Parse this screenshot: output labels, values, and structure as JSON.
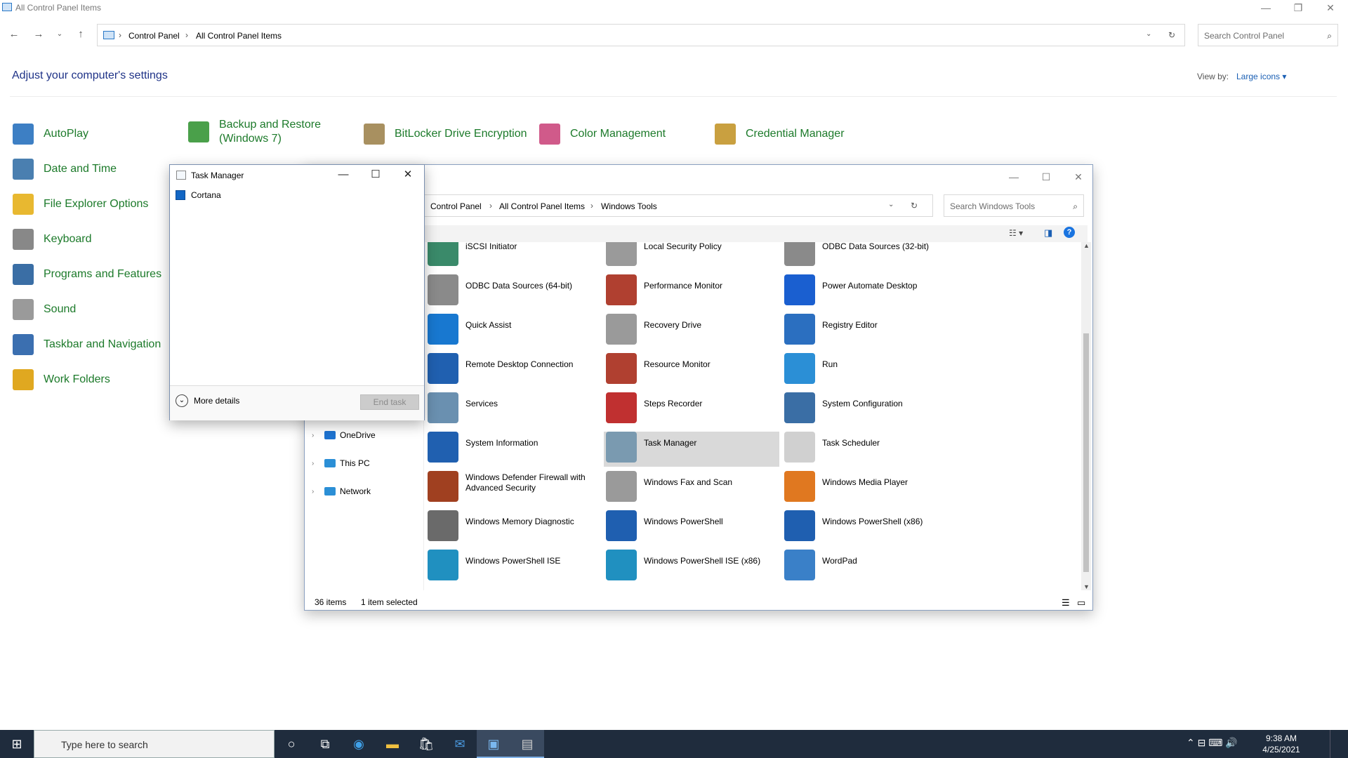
{
  "control_panel": {
    "title": "All Control Panel Items",
    "breadcrumb": [
      "Control Panel",
      "All Control Panel Items"
    ],
    "search_placeholder": "Search Control Panel",
    "heading": "Adjust your computer's settings",
    "view_by_label": "View by:",
    "view_by_value": "Large icons ▾",
    "items": [
      {
        "label": "AutoPlay",
        "icon": "autoplay-icon",
        "color": "#3d7fc4"
      },
      {
        "label": "Backup and Restore\n(Windows 7)",
        "icon": "backup-restore-icon",
        "color": "#4aa04a"
      },
      {
        "label": "BitLocker Drive Encryption",
        "icon": "bitlocker-icon",
        "color": "#a89060"
      },
      {
        "label": "Color Management",
        "icon": "color-management-icon",
        "color": "#d05a8a"
      },
      {
        "label": "Credential Manager",
        "icon": "credential-manager-icon",
        "color": "#c9a040"
      },
      {
        "label": "Date and Time",
        "icon": "date-time-icon",
        "color": "#4a7fb0"
      },
      {
        "label": "File Explorer Options",
        "icon": "folder-options-icon",
        "color": "#e8b830"
      },
      {
        "label": "Keyboard",
        "icon": "keyboard-icon",
        "color": "#888888"
      },
      {
        "label": "Programs and Features",
        "icon": "programs-features-icon",
        "color": "#3a6ea5"
      },
      {
        "label": "Sound",
        "icon": "sound-icon",
        "color": "#9a9a9a"
      },
      {
        "label": "Taskbar and Navigation",
        "icon": "taskbar-nav-icon",
        "color": "#3b6fb0"
      },
      {
        "label": "Work Folders",
        "icon": "work-folders-icon",
        "color": "#e0a820"
      }
    ]
  },
  "windows_tools": {
    "breadcrumb": [
      "Control Panel",
      "All Control Panel Items",
      "Windows Tools"
    ],
    "search_placeholder": "Search Windows Tools",
    "nav": [
      {
        "label": "OneDrive",
        "icon": "onedrive-icon",
        "color": "#1e73d0"
      },
      {
        "label": "This PC",
        "icon": "this-pc-icon",
        "color": "#2b8fd6"
      },
      {
        "label": "Network",
        "icon": "network-icon",
        "color": "#2b8fd6"
      }
    ],
    "items": [
      {
        "label": "iSCSI Initiator",
        "icon": "iscsi-icon",
        "color": "#3a8a6a"
      },
      {
        "label": "Local Security Policy",
        "icon": "local-security-policy-icon",
        "color": "#9a9a9a"
      },
      {
        "label": "ODBC Data Sources (32-bit)",
        "icon": "odbc-icon",
        "color": "#8a8a8a"
      },
      {
        "label": "ODBC Data Sources (64-bit)",
        "icon": "odbc-icon",
        "color": "#8a8a8a"
      },
      {
        "label": "Performance Monitor",
        "icon": "performance-monitor-icon",
        "color": "#b04030"
      },
      {
        "label": "Power Automate Desktop",
        "icon": "power-automate-icon",
        "color": "#1a5fd0"
      },
      {
        "label": "Quick Assist",
        "icon": "quick-assist-icon",
        "color": "#1878d0"
      },
      {
        "label": "Recovery Drive",
        "icon": "recovery-drive-icon",
        "color": "#9a9a9a"
      },
      {
        "label": "Registry Editor",
        "icon": "registry-editor-icon",
        "color": "#2b6fc0"
      },
      {
        "label": "Remote Desktop Connection",
        "icon": "remote-desktop-icon",
        "color": "#2060b0"
      },
      {
        "label": "Resource Monitor",
        "icon": "resource-monitor-icon",
        "color": "#b04030"
      },
      {
        "label": "Run",
        "icon": "run-icon",
        "color": "#2b8fd6"
      },
      {
        "label": "Services",
        "icon": "services-icon",
        "color": "#6a90b0"
      },
      {
        "label": "Steps Recorder",
        "icon": "steps-recorder-icon",
        "color": "#c03030"
      },
      {
        "label": "System Configuration",
        "icon": "system-configuration-icon",
        "color": "#3a6ea5"
      },
      {
        "label": "System Information",
        "icon": "system-information-icon",
        "color": "#2060b0"
      },
      {
        "label": "Task Manager",
        "icon": "task-manager-icon",
        "color": "#7a9ab0",
        "selected": true
      },
      {
        "label": "Task Scheduler",
        "icon": "task-scheduler-icon",
        "color": "#d0d0d0"
      },
      {
        "label": "Windows Defender Firewall with Advanced Security",
        "icon": "firewall-icon",
        "color": "#a04020"
      },
      {
        "label": "Windows Fax and Scan",
        "icon": "fax-scan-icon",
        "color": "#9a9a9a"
      },
      {
        "label": "Windows Media Player",
        "icon": "media-player-icon",
        "color": "#e07820"
      },
      {
        "label": "Windows Memory Diagnostic",
        "icon": "memory-diagnostic-icon",
        "color": "#6a6a6a"
      },
      {
        "label": "Windows PowerShell",
        "icon": "powershell-icon",
        "color": "#1f5fb0"
      },
      {
        "label": "Windows PowerShell (x86)",
        "icon": "powershell-icon",
        "color": "#1f5fb0"
      },
      {
        "label": "Windows PowerShell ISE",
        "icon": "powershell-ise-icon",
        "color": "#2090c0"
      },
      {
        "label": "Windows PowerShell ISE (x86)",
        "icon": "powershell-ise-icon",
        "color": "#2090c0"
      },
      {
        "label": "WordPad",
        "icon": "wordpad-icon",
        "color": "#3a80c8"
      }
    ],
    "status_count": "36 items",
    "status_selected": "1 item selected"
  },
  "task_manager": {
    "title": "Task Manager",
    "process": "Cortana",
    "more_details": "More details",
    "end_task": "End task"
  },
  "taskbar": {
    "search_placeholder": "Type here to search",
    "time": "9:38 AM",
    "date": "4/25/2021"
  }
}
